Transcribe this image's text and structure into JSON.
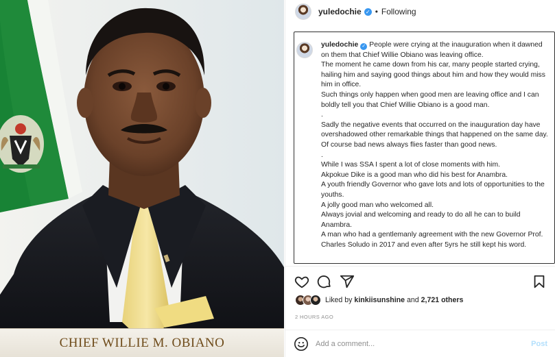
{
  "photo": {
    "caption": "CHIEF WILLIE M. OBIANO"
  },
  "post": {
    "username": "yuledochie",
    "follow_status": "Following",
    "separator": "•",
    "caption_username": "yuledochie",
    "caption_lines": [
      "People were crying at the inauguration when it dawned on them that Chief Willie Obiano was leaving office.",
      "The moment he came down from his car, many people started crying, hailing him and saying good things about him and how they would miss him in office.",
      "Such things only happen when good men are leaving office and I can boldly tell you that Chief Willie Obiano is a good man.",
      ".",
      "Sadly the negative events that occurred on the inauguration day have overshadowed other remarkable things that happened on the same day.",
      "Of course bad news always flies faster than good news.",
      ".",
      "While I was SSA I spent a lot of close moments with him.",
      "Akpokue Dike is a good man who did his best for Anambra.",
      "A youth friendly Governor who gave lots and lots of opportunities to the youths.",
      "A jolly good man who welcomed all.",
      "Always jovial and welcoming and ready to do all he can to build Anambra.",
      "A man who had a gentlemanly agreement with the new Governor Prof. Charles Soludo in 2017 and even after 5yrs he still kept his word."
    ],
    "likes_prefix": "Liked by",
    "likes_user": "kinkiisunshine",
    "likes_and": "and",
    "likes_count": "2,721 others",
    "timestamp": "2 HOURS AGO",
    "comment_placeholder": "Add a comment...",
    "post_button": "Post"
  },
  "icons": {
    "like": "heart-icon",
    "comment": "comment-icon",
    "share": "share-icon",
    "save": "bookmark-icon",
    "emoji": "emoji-icon",
    "verified": "verified-badge-icon"
  },
  "colors": {
    "verified_blue": "#3897f0",
    "post_button_disabled": "#b2dffc",
    "muted_text": "#8e8e8e",
    "caption_border": "#2f2f2f"
  }
}
